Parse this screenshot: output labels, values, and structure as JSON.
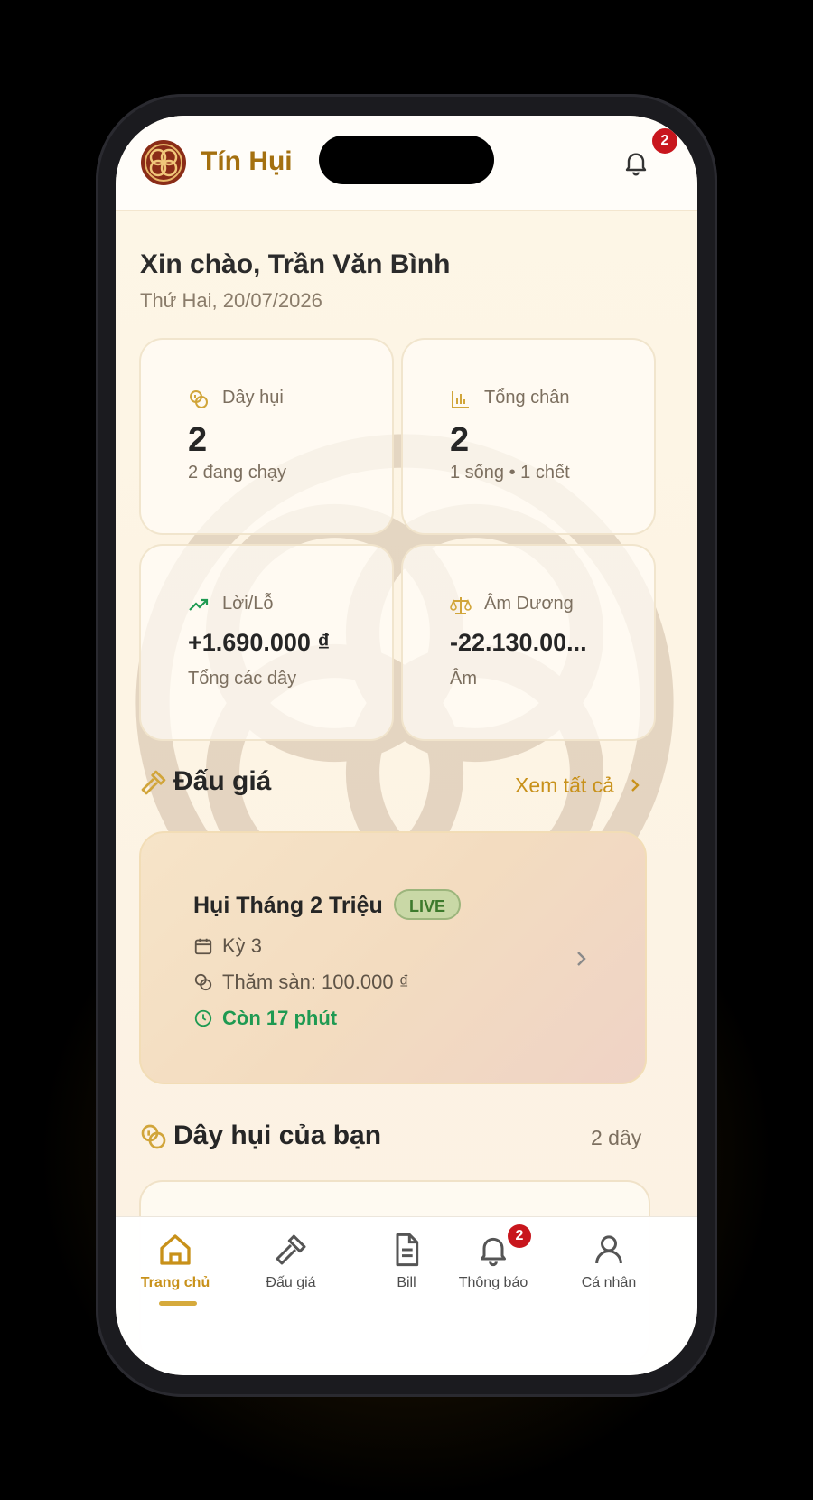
{
  "app": {
    "name": "Tín Hụi",
    "notification_count": "2"
  },
  "greeting": {
    "text": "Xin chào, Trần Văn Bình",
    "date": "Thứ Hai, 20/07/2026"
  },
  "stats": [
    {
      "icon": "coins-icon",
      "label": "Dây hụi",
      "value": "2",
      "sub": "2 đang chạy"
    },
    {
      "icon": "bar-chart-icon",
      "label": "Tổng chân",
      "value": "2",
      "sub": "1 sống • 1 chết"
    },
    {
      "icon": "trend-up-icon",
      "label": "Lời/Lỗ",
      "value": "+1.690.000 ₫",
      "sub": "Tổng các dây"
    },
    {
      "icon": "scale-icon",
      "label": "Âm Dương",
      "value": "-22.130.00...",
      "sub": "Âm"
    }
  ],
  "auction_section": {
    "title": "Đấu giá",
    "see_all": "Xem tất cả"
  },
  "auction_card": {
    "title": "Hụi Tháng 2 Triệu",
    "badge": "LIVE",
    "period": "Kỳ 3",
    "floor": "Thăm sàn: 100.000 ₫",
    "time_left": "Còn 17 phút"
  },
  "my_groups": {
    "title": "Dây hụi của bạn",
    "count": "2 dây"
  },
  "tabs": [
    {
      "icon": "home-icon",
      "label": "Trang chủ",
      "active": true
    },
    {
      "icon": "gavel-icon",
      "label": "Đấu giá"
    },
    {
      "icon": "document-icon",
      "label": "Bill"
    },
    {
      "icon": "bell-icon",
      "label": "Thông báo",
      "badge": "2"
    },
    {
      "icon": "user-icon",
      "label": "Cá nhân"
    }
  ],
  "colors": {
    "accent": "#c8911a",
    "brand": "#a4700f",
    "badge": "#c8161d",
    "live_green": "#1f9a52"
  }
}
